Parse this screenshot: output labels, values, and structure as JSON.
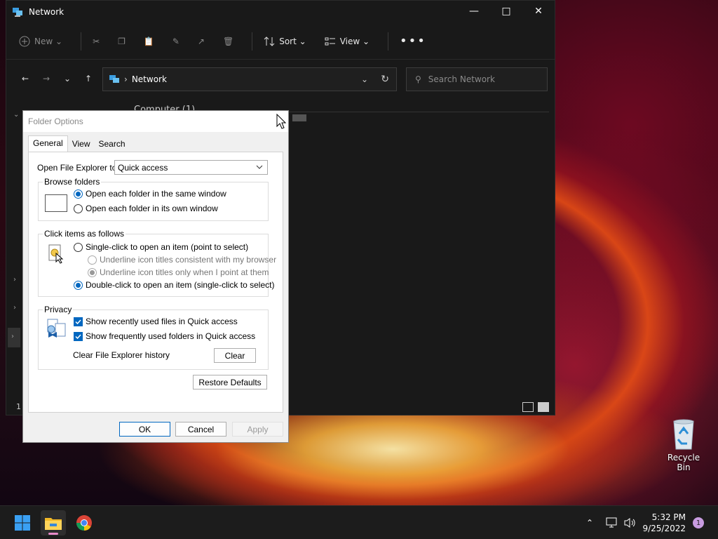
{
  "explorer": {
    "title": "Network",
    "commands": {
      "new": "New",
      "sort": "Sort",
      "view": "View"
    },
    "address": "Network",
    "search_placeholder": "Search Network",
    "content_heading": "Computer (1)",
    "status_count": "1"
  },
  "dialog": {
    "title": "Folder Options",
    "tabs": [
      "General",
      "View",
      "Search"
    ],
    "open_label": "Open File Explorer to:",
    "open_value": "Quick access",
    "browse": {
      "label": "Browse folders",
      "opt_same": "Open each folder in the same window",
      "opt_own": "Open each folder in its own window"
    },
    "click": {
      "label": "Click items as follows",
      "single": "Single-click to open an item (point to select)",
      "underline_browser": "Underline icon titles consistent with my browser",
      "underline_point": "Underline icon titles only when I point at them",
      "double": "Double-click to open an item (single-click to select)"
    },
    "privacy": {
      "label": "Privacy",
      "recent_files": "Show recently used files in Quick access",
      "frequent_folders": "Show frequently used folders in Quick access",
      "clear_label": "Clear File Explorer history",
      "clear_button": "Clear"
    },
    "restore_defaults": "Restore Defaults",
    "ok": "OK",
    "cancel": "Cancel",
    "apply": "Apply"
  },
  "desktop": {
    "recycle_bin": "Recycle Bin"
  },
  "taskbar": {
    "time": "5:32 PM",
    "date": "9/25/2022",
    "notifications": "1"
  },
  "colors": {
    "accent": "#0067c0",
    "explorer_bg": "#191919",
    "taskbar_bg": "#1c1c1c"
  }
}
